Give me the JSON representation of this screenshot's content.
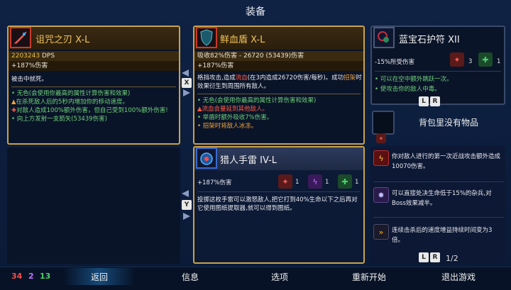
{
  "title": "装备",
  "weapon1": {
    "name": "诅咒之刃 X-L",
    "dps": "2203243",
    "dps_unit": "DPS",
    "bonus": "+187%伤害",
    "desc": "被击中就死。",
    "bullets": [
      {
        "text": "无色(会使用你最高的属性计算伤害和效果)",
        "color": "g"
      },
      {
        "text": "在杀死敌人后的5秒内增加你的移动速度。",
        "color": "g"
      },
      {
        "text": "对敌人造成100%额外伤害，但自己受到100%额外伤害!",
        "color": "g"
      },
      {
        "text": "向上方发射一支箭矢(53439伤害)",
        "color": "g"
      }
    ]
  },
  "shield": {
    "name": "鲜血盾 X-L",
    "stat1": "吸收82%伤害 - 26720 (53439)伤害",
    "bonus": "+187%伤害",
    "desc_a": "格挡攻击,造成",
    "desc_blood": "流血",
    "desc_b": "(在3内造成26720伤害/每秒)。成功",
    "desc_parry": "招架",
    "desc_c": "时效果衍生到周围所有敌人。",
    "bullets": [
      {
        "text": "无色(会使用你最高的属性计算伤害和效果)",
        "color": "g"
      },
      {
        "text": "流血会蔓延到其他敌人。",
        "color": "r"
      },
      {
        "text": "举盾时额外吸收7%伤害。",
        "color": "g"
      },
      {
        "text": "招架时将敌人冰冻。",
        "color": "o"
      }
    ]
  },
  "grenade": {
    "name": "猎人手雷 IV-L",
    "bonus": "+187%伤害",
    "scrolls": [
      "1",
      "1",
      "1"
    ],
    "desc": "投掷这枚手雷可以激怒敌人,把它打到40%生命以下之后再对它使用图纸提取器,就可以得到图纸。"
  },
  "amulet": {
    "name": "蓝宝石护符 XII",
    "stat": "-15%所受伤害",
    "scroll_count": "3",
    "scroll_count2": "1",
    "bullets": [
      "可以在空中额外跳跃一次。",
      "使攻击你的敌人中毒。"
    ]
  },
  "backpack": {
    "label": "背包里没有物品"
  },
  "perks": [
    "你对敌人进行的第一次近战攻击额外造成10070伤害。",
    "可以直接处决生命低于15%的杂兵,对Boss效果减半。",
    "连续击杀后的速度增益持续时间变为3倍。"
  ],
  "keys": {
    "swap_x": "X",
    "swap_y": "Y",
    "page_prev": "L",
    "page_next": "R",
    "amulet_prev": "L",
    "amulet_next": "R"
  },
  "page_indicator": "1/2",
  "stats": {
    "red": "34",
    "purple": "2",
    "green": "13"
  },
  "menu": {
    "back": "返回",
    "info": "信息",
    "options": "选项",
    "restart": "重新开始",
    "quit": "退出游戏"
  },
  "colors": {
    "gold": "#c9a24a",
    "red_stat": "#ff4a4a",
    "purple_stat": "#c070ff",
    "green_stat": "#4ad06a"
  }
}
